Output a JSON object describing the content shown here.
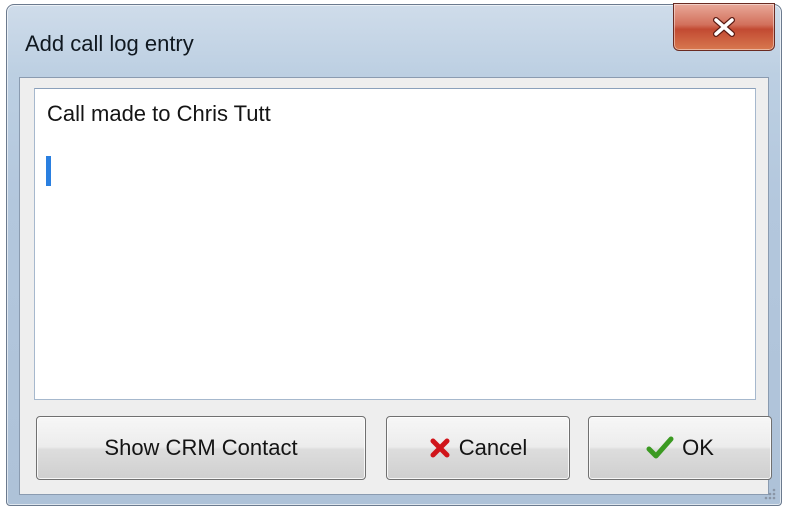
{
  "window": {
    "title": "Add call log entry",
    "close_icon": "close-icon"
  },
  "editor": {
    "value": "Call made to Chris Tutt"
  },
  "buttons": {
    "show_crm_contact": "Show CRM Contact",
    "cancel": "Cancel",
    "cancel_icon": "red-x-icon",
    "ok": "OK",
    "ok_icon": "green-check-icon"
  },
  "colors": {
    "close_button": "#c24a32",
    "caret": "#2a7fe0",
    "cancel_icon": "#d0141a",
    "ok_icon": "#3b9a22"
  }
}
